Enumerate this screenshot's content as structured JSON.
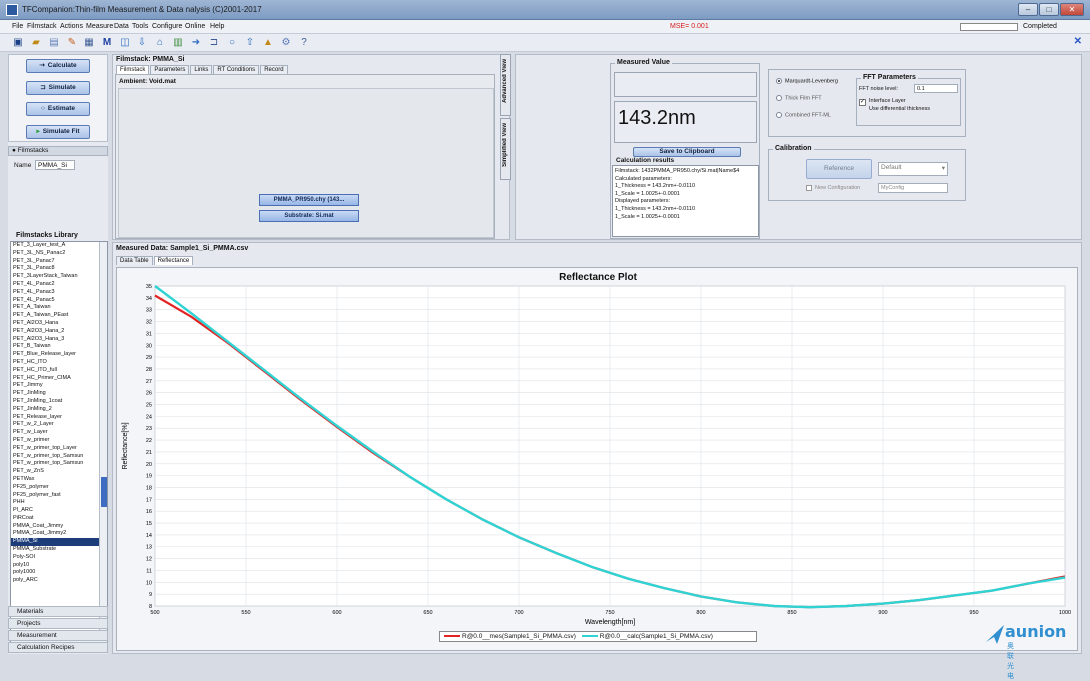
{
  "window": {
    "title": "TFCompanion:Thin-film Measurement & Data nalysis (C)2001-2017"
  },
  "menu": {
    "items": [
      "File",
      "Filmstack",
      "Actions",
      "Measure",
      "Data",
      "Tools",
      "Configure",
      "Online",
      "Help"
    ],
    "mse": "MSE= 0.001",
    "status": "Completed"
  },
  "toolbar": {
    "icons": [
      "save-icon",
      "open-icon",
      "new-icon",
      "edit-icon",
      "report-icon",
      "m-icon",
      "layers-icon",
      "down-icon",
      "home-icon",
      "chart-icon",
      "arrow-right-icon",
      "simulate-icon",
      "circle-icon",
      "up-icon",
      "stack-icon",
      "tools-icon",
      "help-icon"
    ]
  },
  "left": {
    "calculate": "Calculate",
    "simulate": "Simulate",
    "estimate": "Estimate",
    "simulate_fit": "Simulate Fit",
    "filmstacks": "Filmstacks",
    "name_label": "Name",
    "name_value": "PMMA_Si",
    "library_title": "Filmstacks Library",
    "library": [
      "PET_3_Layer_test_A",
      "PET_3L_NS_Panac2",
      "PET_3L_Panac7",
      "PET_3L_Panac8",
      "PET_3LayerStack_Taiwan",
      "PET_4L_Panac2",
      "PET_4L_Panac3",
      "PET_4L_Panac5",
      "PET_A_Taiwan",
      "PET_A_Taiwan_PEast",
      "PET_Al2O3_Hana",
      "PET_Al2O3_Hana_2",
      "PET_Al2O3_Hana_3",
      "PET_B_Taiwan",
      "PET_Blue_Release_layer",
      "PET_HC_ITO",
      "PET_HC_ITO_full",
      "PET_HC_Primer_CIMA",
      "PET_Jimmy",
      "PET_JinMing",
      "PET_JinMing_1coat",
      "PET_JinMing_2",
      "PET_Release_layer",
      "PET_w_2_Layer",
      "PET_w_Layer",
      "PET_w_primer",
      "PET_w_primer_top_Layer",
      "PET_w_primer_top_Samsun",
      "PET_w_primer_top_Samsun",
      "PET_w_ZnS",
      "PETWax",
      "PF25_polymer",
      "PF25_polymer_fast",
      "PHH",
      "PI_ARC",
      "PiRCoat",
      "PMMA_Coat_Jimmy",
      "PMMA_Coat_Jimmy2",
      "PMMA_Si",
      "PMMA_Substrate",
      "Poly-SOI",
      "poly10",
      "poly1000",
      "poly_ARC"
    ],
    "selected_index": 38,
    "sections": [
      "Materials",
      "Projects",
      "Measurement",
      "Calculation Recipes"
    ]
  },
  "filmstack": {
    "title": "Filmstack: PMMA_Si",
    "tabs": [
      "Filmstack",
      "Parameters",
      "Links",
      "RT Conditions",
      "Record"
    ],
    "ambient": "Ambient: Void.mat",
    "layer_button": "PMMA_PR950.chy (143...",
    "substrate_button": "Substrate: Si.mat",
    "side_tabs": [
      "Advanced View",
      "Simplified View"
    ]
  },
  "measured_value": {
    "title": "Measured Value",
    "value": "143.2nm",
    "save_button": "Save to Clipboard",
    "results_title": "Calculation results",
    "results": [
      "Filmstack: 1432PMMA_PR950.chy/Si.mat|Name$4",
      "Calculated parameters:",
      "1_Thickness = 143.2nm+-0.0110",
      "1_Scale = 1.0025+-0.0001",
      "Displayed parameters:",
      "1_Thickness = 143.2nm+-0.0110",
      "1_Scale = 1.0025+-0.0001"
    ]
  },
  "method": {
    "options": [
      "Marquardt-Levenberg",
      "Thick Film FFT",
      "Combined FFT-ML"
    ],
    "selected": 0
  },
  "fft": {
    "title": "FFT Parameters",
    "noise_label": "FFT noise level:",
    "noise_value": "0.1",
    "interface_label": "Interface Layer",
    "interface_sub": "Use differential thickness"
  },
  "calibration": {
    "title": "Calibration",
    "reference_button": "Reference",
    "default_value": "Default",
    "new_config_label": "New Configuration",
    "config_value": "MyConfig"
  },
  "measured": {
    "title": "Measured Data: Sample1_Si_PMMA.csv",
    "tabs": [
      "Data Table",
      "Reflectance"
    ],
    "active_tab": 1
  },
  "chart_data": {
    "type": "line",
    "title": "Reflectance Plot",
    "xlabel": "Wavelength[nm]",
    "ylabel": "Reflectance[%]",
    "xlim": [
      500,
      1000
    ],
    "ylim": [
      8,
      35
    ],
    "x_ticks": [
      500,
      550,
      600,
      650,
      700,
      750,
      800,
      850,
      900,
      950,
      1000
    ],
    "y_ticks": [
      8,
      9,
      10,
      11,
      12,
      13,
      14,
      15,
      16,
      17,
      18,
      19,
      20,
      21,
      22,
      23,
      24,
      25,
      26,
      27,
      28,
      29,
      30,
      31,
      32,
      33,
      34,
      35
    ],
    "grid": true,
    "legend_position": "bottom",
    "x": [
      500,
      520,
      540,
      560,
      580,
      600,
      620,
      640,
      660,
      680,
      700,
      720,
      740,
      760,
      780,
      800,
      820,
      840,
      860,
      880,
      900,
      920,
      940,
      960,
      980,
      1000
    ],
    "series": [
      {
        "name": "R@0.0__mes(Sample1_Si_PMMA.csv)",
        "color": "#e32424",
        "values": [
          34.2,
          32.4,
          30.2,
          27.8,
          25.4,
          23.1,
          20.9,
          18.9,
          17.0,
          15.3,
          13.8,
          12.5,
          11.3,
          10.3,
          9.5,
          8.8,
          8.3,
          8.0,
          7.9,
          8.0,
          8.2,
          8.5,
          8.9,
          9.3,
          9.9,
          10.5
        ]
      },
      {
        "name": "R@0.0__calc(Sample1_Si_PMMA.csv)",
        "color": "#2fd3d3",
        "values": [
          35.0,
          32.7,
          30.3,
          27.9,
          25.5,
          23.2,
          21.0,
          18.9,
          17.0,
          15.3,
          13.8,
          12.5,
          11.3,
          10.3,
          9.5,
          8.8,
          8.3,
          8.0,
          7.9,
          8.0,
          8.2,
          8.5,
          8.9,
          9.3,
          9.9,
          10.4
        ]
      }
    ]
  },
  "logo": {
    "brand": "aunion",
    "subtitle": "奥联光电"
  }
}
